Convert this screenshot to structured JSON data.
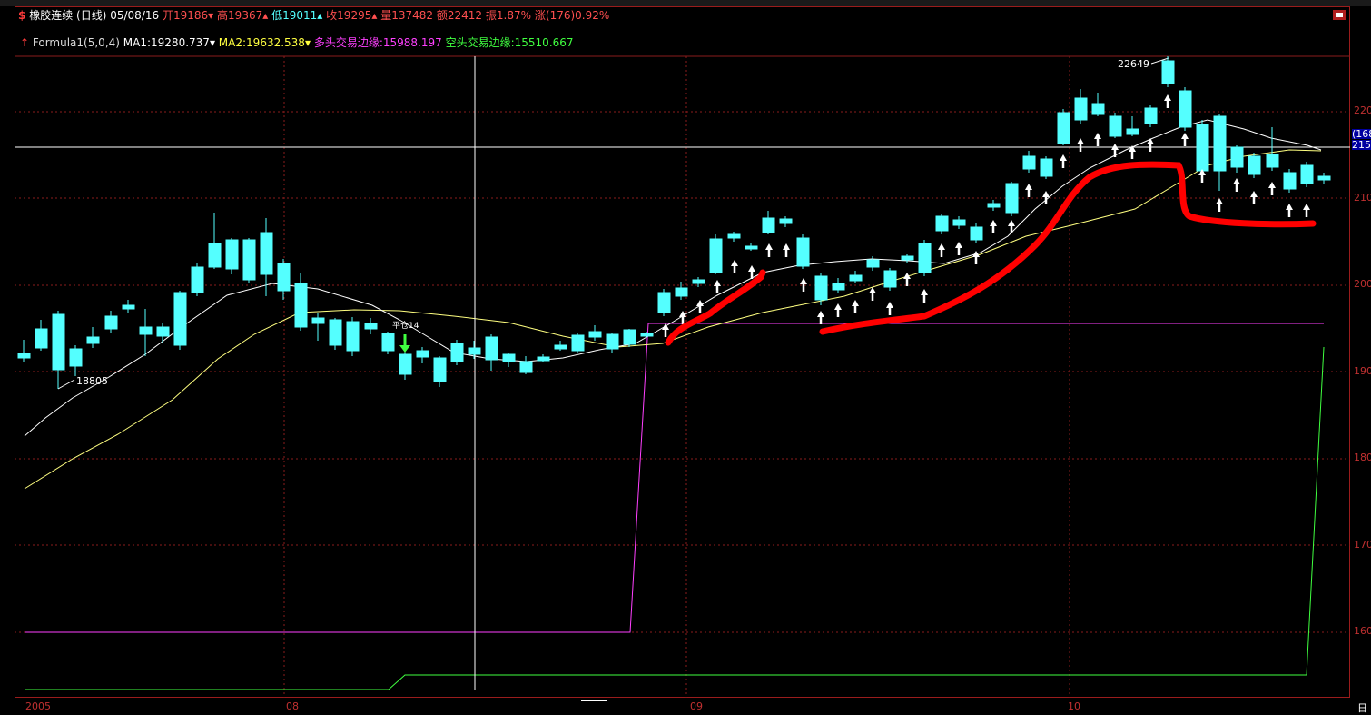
{
  "header": {
    "symbol_name": "橡胶连续",
    "period": "(日线)",
    "date": "05/08/16",
    "open_label": "开",
    "open": "19186",
    "high_label": "高",
    "high": "19367",
    "low_label": "低",
    "low": "19011",
    "close_label": "收",
    "close": "19295",
    "volume_label": "量",
    "volume": "137482",
    "amount_label": "额",
    "amount": "22412",
    "amplitude_label": "振",
    "amplitude": "1.87%",
    "change_label": "涨",
    "change": "(176)0.92%"
  },
  "indicator_line": {
    "formula": "Formula1(5,0,4)",
    "ma1_label": "MA1:",
    "ma1": "19280.737",
    "ma2_label": "MA2:",
    "ma2": "19632.538",
    "long_edge_label": "多头交易边缘:",
    "long_edge": "15988.197",
    "short_edge_label": "空头交易边缘:",
    "short_edge": "15510.667"
  },
  "annotations": {
    "high_mark": "22649",
    "low_mark": "18805",
    "close_signal": "平仓14"
  },
  "price_scale": {
    "cursor_top": "(168",
    "cursor_price": "215",
    "ticks": [
      "220",
      "210",
      "200",
      "190",
      "180",
      "170",
      "160"
    ]
  },
  "time_axis": {
    "labels": [
      "2005",
      "08",
      "09",
      "10"
    ],
    "right_label": "日"
  },
  "colors": {
    "up_candle": "#ff3c3c",
    "down_candle": "#54ffff",
    "ma1": "#ffffff",
    "ma2": "#ffff80",
    "long_edge": "#ff40ff",
    "short_edge": "#40ff40",
    "marker_red": "#ff0000",
    "grid": "#8a1c1c"
  },
  "icons": {
    "app_icon": "red-s-icon",
    "formula_arrow": "red-up-arrow-icon",
    "corner_icon": "red-chart-icon",
    "buy_arrow": "white-up-arrow-icon",
    "sell_arrow": "green-down-arrow-icon"
  }
}
